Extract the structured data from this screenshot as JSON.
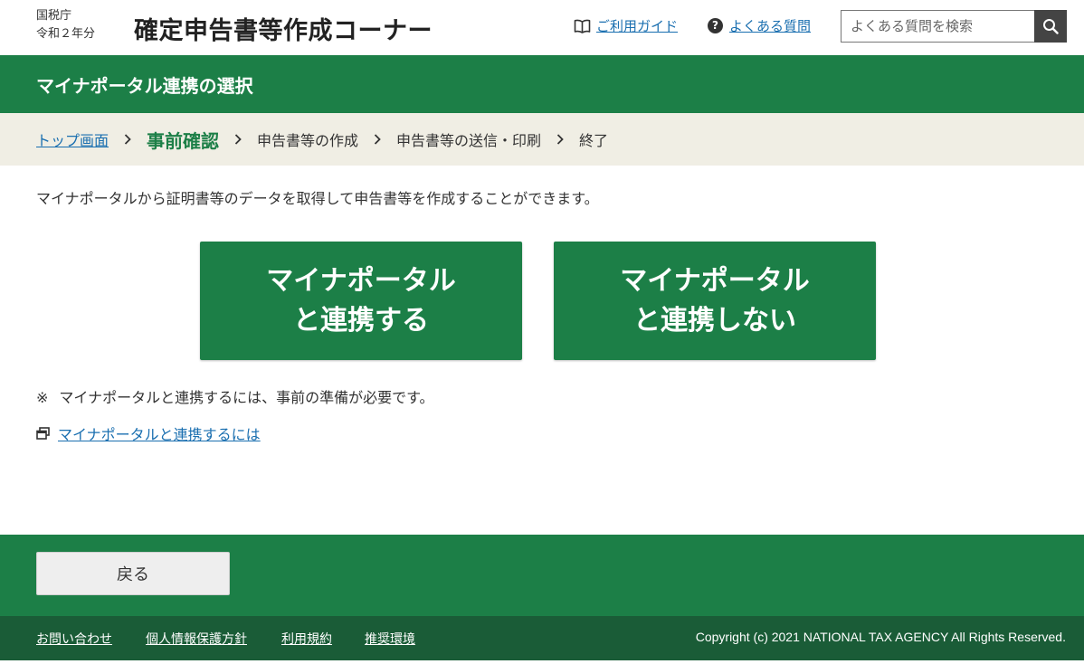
{
  "header": {
    "agency_line1": "国税庁",
    "agency_line2": "令和２年分",
    "app_title": "確定申告書等作成コーナー",
    "guide_link": "ご利用ガイド",
    "faq_link": "よくある質問",
    "faq_icon_glyph": "?",
    "search": {
      "placeholder": "よくある質問を検索",
      "value": ""
    }
  },
  "titlebar": {
    "title": "マイナポータル連携の選択"
  },
  "steps": {
    "items": [
      {
        "label": "トップ画面",
        "state": "link"
      },
      {
        "label": "事前確認",
        "state": "current"
      },
      {
        "label": "申告書等の作成",
        "state": "upcoming"
      },
      {
        "label": "申告書等の送信・印刷",
        "state": "upcoming"
      },
      {
        "label": "終了",
        "state": "upcoming"
      }
    ]
  },
  "main": {
    "intro": "マイナポータルから証明書等のデータを取得して申告書等を作成することができます。",
    "link_button": {
      "line1": "マイナポータル",
      "line2": "と連携する"
    },
    "nolink_button": {
      "line1": "マイナポータル",
      "line2": "と連携しない"
    },
    "note_mark": "※",
    "note": "マイナポータルと連携するには、事前の準備が必要です。",
    "help_link": "マイナポータルと連携するには"
  },
  "footer": {
    "back_label": "戻る",
    "links": [
      "お問い合わせ",
      "個人情報保護方針",
      "利用規約",
      "推奨環境"
    ],
    "copyright": "Copyright (c) 2021 NATIONAL TAX AGENCY All Rights Reserved."
  },
  "colors": {
    "brand_green": "#1c7f47",
    "footer_dark_green": "#1a5c37",
    "link_blue": "#1a6fb0",
    "step_bg": "#f0eee4"
  },
  "icons": {
    "guide": "open-book-icon",
    "faq": "question-circle-icon",
    "search": "magnifier-icon",
    "chevron": "chevron-right-icon",
    "external": "new-window-icon"
  }
}
